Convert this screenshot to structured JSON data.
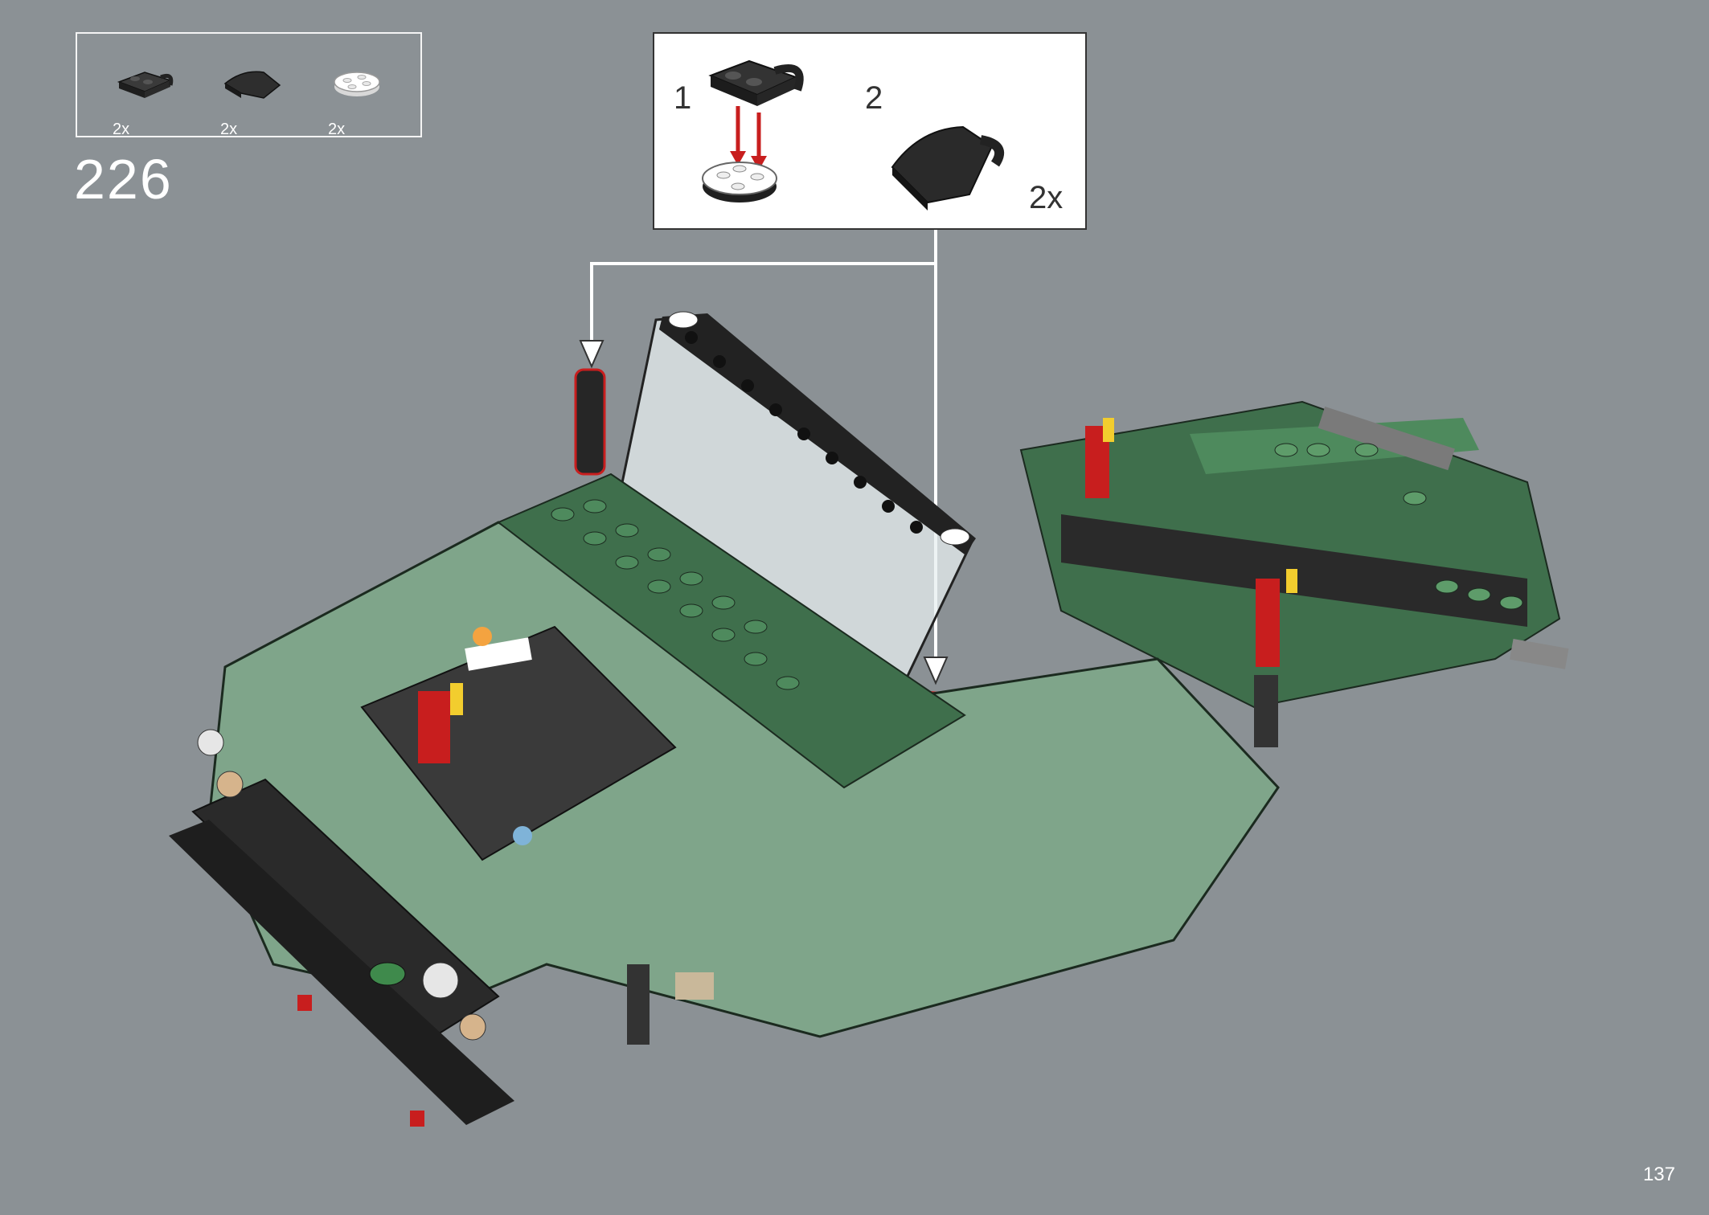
{
  "parts_list": {
    "items": [
      {
        "name": "black-plate-with-clip",
        "qty": "2x"
      },
      {
        "name": "black-curved-slope",
        "qty": "2x"
      },
      {
        "name": "white-round-plate",
        "qty": "2x"
      }
    ]
  },
  "step": {
    "number": "226"
  },
  "callout": {
    "substeps": [
      {
        "label": "1"
      },
      {
        "label": "2"
      }
    ],
    "qty": "2x"
  },
  "page": {
    "number": "137"
  },
  "colors": {
    "background": "#8b9195",
    "sand_green": "#7fa58a",
    "dark_green": "#3f6f4c",
    "black": "#262626",
    "red": "#c81e1e",
    "yellow": "#f2cd2e"
  }
}
